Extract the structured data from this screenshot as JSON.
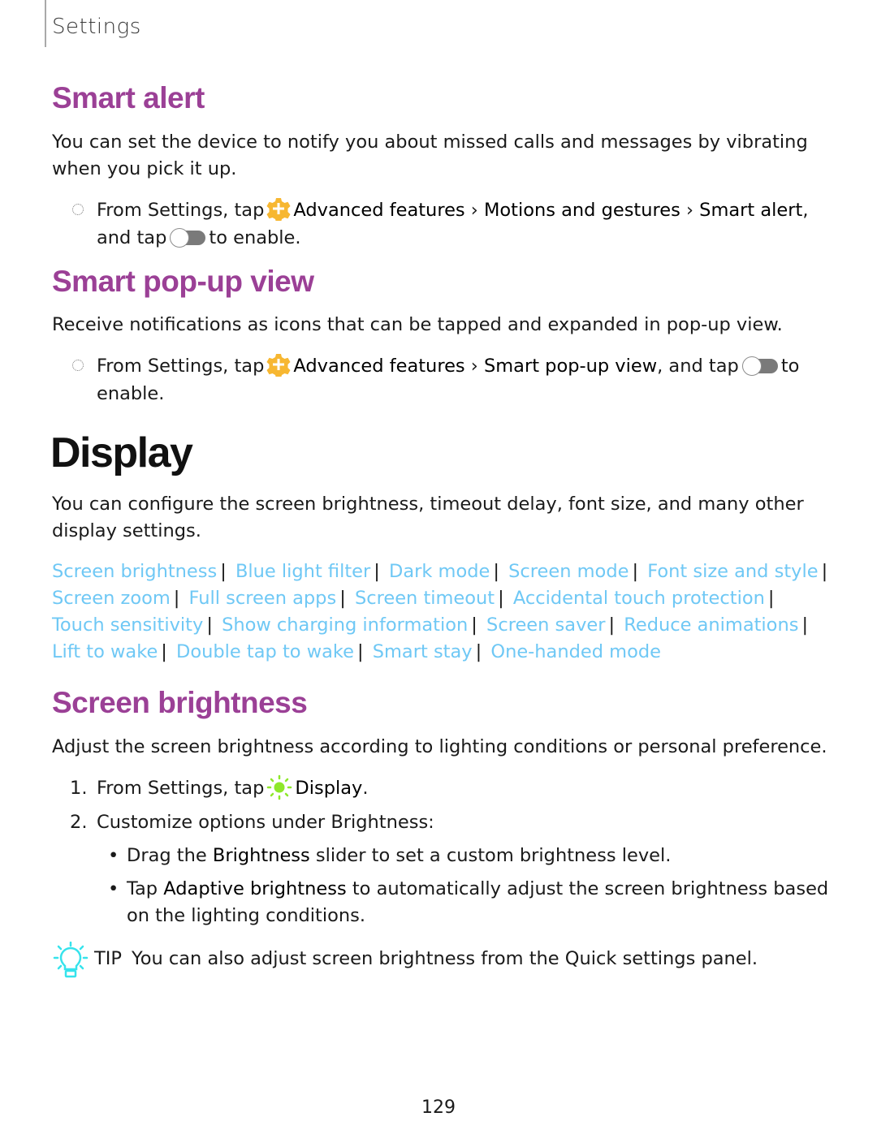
{
  "header": {
    "title": "Settings"
  },
  "smart_alert": {
    "heading": "Smart alert",
    "description": "You can set the device to notify you about missed calls and messages by vibrating when you pick it up.",
    "step": {
      "prefix": "From Settings, tap",
      "icon": "advanced-features-gear-icon",
      "path": [
        "Advanced features",
        "Motions and gestures",
        "Smart alert"
      ],
      "separator": "›",
      "mid": ", ",
      "line2_prefix": "and tap",
      "toggle_icon": "toggle-off-icon",
      "suffix": "to enable."
    }
  },
  "smart_popup": {
    "heading": "Smart pop-up view",
    "description": "Receive notifications as icons that can be tapped and expanded in pop-up view.",
    "step": {
      "prefix": "From Settings, tap",
      "icon": "advanced-features-gear-icon",
      "path": [
        "Advanced features",
        "Smart pop-up view"
      ],
      "separator": "›",
      "mid": ", and tap",
      "toggle_icon": "toggle-off-icon",
      "suffix": "to",
      "line2": "enable."
    }
  },
  "display": {
    "heading": "Display",
    "description": "You can configure the screen brightness, timeout delay, font size, and many other display settings.",
    "links": [
      "Screen brightness",
      "Blue light filter",
      "Dark mode",
      "Screen mode",
      "Font size and style",
      "Screen zoom",
      "Full screen apps",
      "Screen timeout",
      "Accidental touch protection",
      "Touch sensitivity",
      "Show charging information",
      "Screen saver",
      "Reduce animations",
      "Lift to wake",
      "Double tap to wake",
      "Smart stay",
      "One-handed mode"
    ],
    "link_separator": "|"
  },
  "screen_brightness": {
    "heading": "Screen brightness",
    "description": "Adjust the screen brightness according to lighting conditions or personal preference.",
    "steps": [
      {
        "num": "1.",
        "prefix": "From Settings, tap",
        "icon": "display-sun-icon",
        "bold": "Display",
        "suffix": "."
      },
      {
        "num": "2.",
        "text": "Customize options under Brightness:"
      }
    ],
    "substeps": [
      {
        "bullet": "•",
        "pre": "Drag the ",
        "bold": "Brightness",
        "post": " slider to set a custom brightness level."
      },
      {
        "bullet": "•",
        "pre": "Tap ",
        "bold": "Adaptive brightness",
        "post": " to automatically adjust the screen brightness based on the lighting conditions."
      }
    ],
    "tip": {
      "icon": "lightbulb-icon",
      "label": "TIP",
      "text": "You can also adjust screen brightness from the Quick settings panel."
    }
  },
  "colors": {
    "heading": "#9b4096",
    "link": "#6fc8f5",
    "gear": "#f7b731",
    "sun": "#8ee82a",
    "tip": "#36e3ec"
  },
  "page_number": "129"
}
